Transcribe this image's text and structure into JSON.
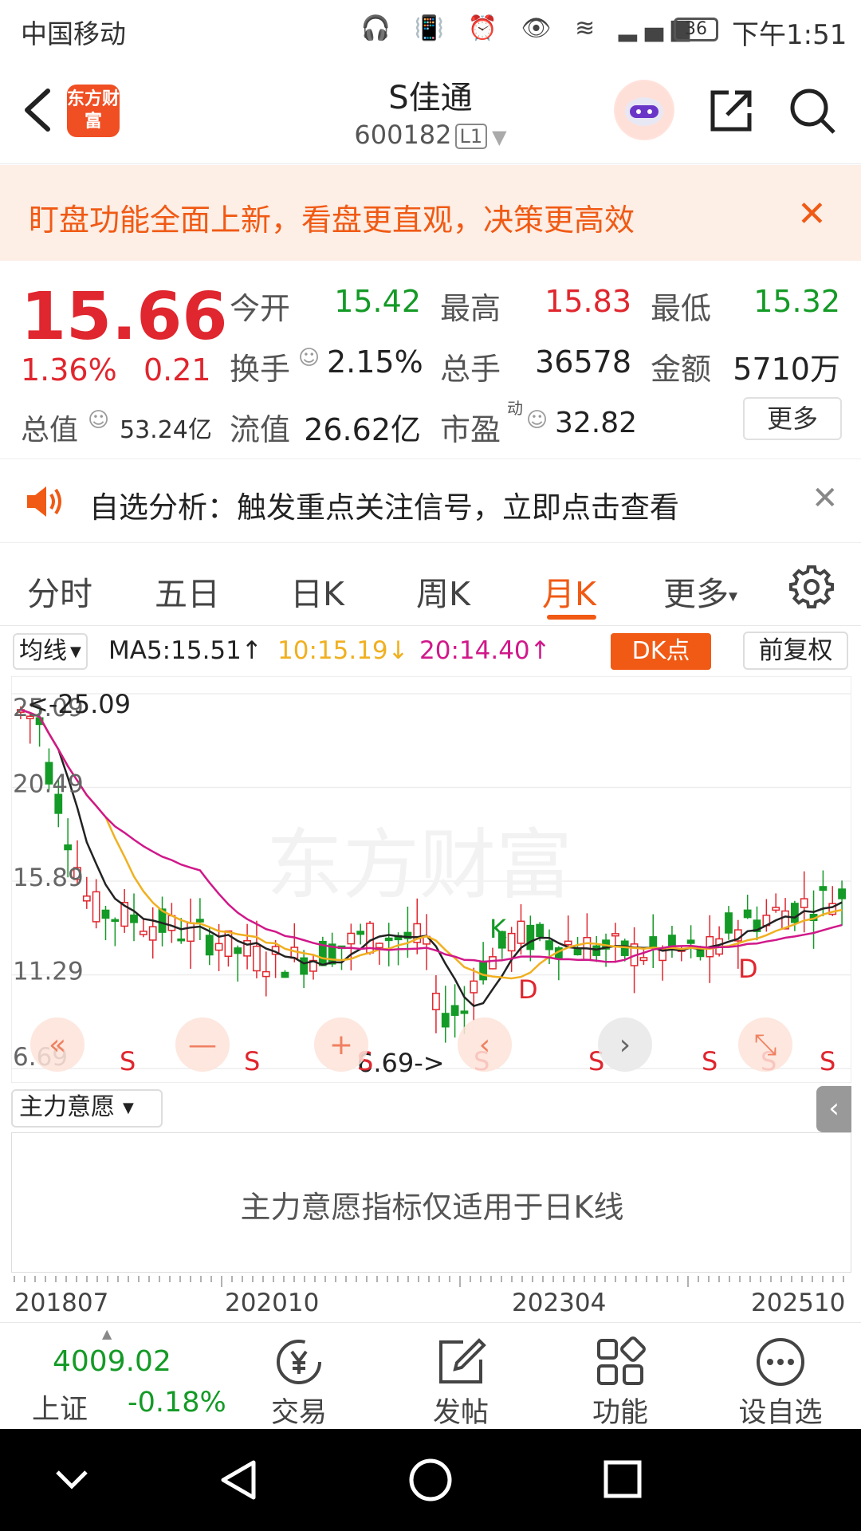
{
  "status_bar": {
    "carrier": "中国移动",
    "battery": "36",
    "time": "下午1:51"
  },
  "header": {
    "logo_text": "东方财富",
    "stock_name": "S佳通",
    "stock_code": "600182",
    "level": "L1"
  },
  "banner": {
    "text": "盯盘功能全面上新，看盘更直观，决策更高效",
    "close": "✕"
  },
  "quote": {
    "price": "15.66",
    "change_pct": "1.36%",
    "change": "0.21",
    "open_label": "今开",
    "open": "15.42",
    "high_label": "最高",
    "high": "15.83",
    "low_label": "最低",
    "low": "15.32",
    "turnover_label": "换手",
    "turnover": "2.15%",
    "volume_label": "总手",
    "volume": "36578",
    "amount_label": "金额",
    "amount": "5710万",
    "mktcap_label": "总值",
    "mktcap": "53.24亿",
    "float_label": "流值",
    "float": "26.62亿",
    "pe_label": "市盈",
    "pe_sup": "动",
    "pe": "32.82",
    "more": "更多"
  },
  "notice": {
    "text": "自选分析：触发重点关注信号，立即点击查看",
    "close": "✕"
  },
  "tabs": [
    {
      "label": "分时"
    },
    {
      "label": "五日"
    },
    {
      "label": "日K"
    },
    {
      "label": "周K"
    },
    {
      "label": "月K"
    },
    {
      "label": "更多"
    }
  ],
  "active_tab": "月K",
  "ma_row": {
    "selector": "均线",
    "ma5": "MA5:15.51",
    "ma10": "10:15.19",
    "ma20": "20:14.40",
    "dk_button": "DK点",
    "adjust_button": "前复权"
  },
  "colors": {
    "accent": "#f05a14",
    "up": "#e0262e",
    "down": "#149a26",
    "ma5": "#222222",
    "ma10": "#f0b020",
    "ma20": "#d0188a"
  },
  "chart_data": {
    "type": "candlestick",
    "y_labels": [
      "25.09",
      "20.49",
      "15.89",
      "11.29",
      "6.69"
    ],
    "ylim": [
      6.69,
      25.09
    ],
    "max_label": "<-25.09",
    "min_label": "6.69->",
    "watermark": "东方财富",
    "x_labels": [
      "201807",
      "202010",
      "202304",
      "202510"
    ],
    "signals": [
      "S",
      "S",
      "S",
      "S",
      "S",
      "S",
      "S",
      "S"
    ],
    "markers": [
      "K",
      "D",
      "D"
    ],
    "controls": [
      "«",
      "—",
      "+",
      "‹",
      "›",
      "⤡"
    ]
  },
  "sub_panel": {
    "selector": "主力意愿",
    "message": "主力意愿指标仅适用于日K线"
  },
  "bottom_bar": {
    "index_value": "4009.02",
    "index_name": "上证",
    "index_pct": "-0.18%",
    "items": [
      {
        "label": "交易",
        "icon": "yuan-icon"
      },
      {
        "label": "发帖",
        "icon": "edit-icon"
      },
      {
        "label": "功能",
        "icon": "grid-icon"
      },
      {
        "label": "设自选",
        "icon": "more-icon"
      }
    ]
  }
}
